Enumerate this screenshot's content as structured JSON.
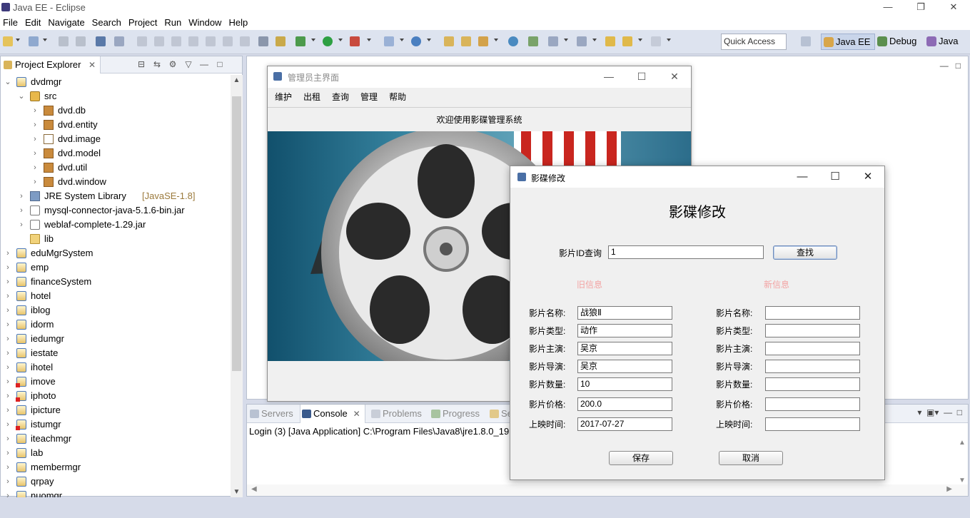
{
  "window": {
    "title": "Java EE - Eclipse",
    "controls": [
      "—",
      "❐",
      "✕"
    ]
  },
  "menubar": [
    "File",
    "Edit",
    "Navigate",
    "Search",
    "Project",
    "Run",
    "Window",
    "Help"
  ],
  "toolbar": {
    "quick_access": "Quick Access",
    "perspectives": [
      {
        "label": "Java EE",
        "active": true
      },
      {
        "label": "Debug",
        "active": false
      },
      {
        "label": "Java",
        "active": false
      }
    ]
  },
  "project_explorer": {
    "tab_label": "Project Explorer",
    "tree": [
      {
        "label": "dvdmgr",
        "icon": "project-icon",
        "twisty": "expanded",
        "level": 0
      },
      {
        "label": "src",
        "icon": "source-folder-icon",
        "twisty": "expanded",
        "level": 1
      },
      {
        "label": "dvd.db",
        "icon": "package-icon",
        "twisty": "collapsed",
        "level": 2
      },
      {
        "label": "dvd.entity",
        "icon": "package-icon",
        "twisty": "collapsed",
        "level": 2
      },
      {
        "label": "dvd.image",
        "icon": "empty-package-icon",
        "twisty": "collapsed",
        "level": 2
      },
      {
        "label": "dvd.model",
        "icon": "package-icon",
        "twisty": "collapsed",
        "level": 2
      },
      {
        "label": "dvd.util",
        "icon": "package-icon",
        "twisty": "collapsed",
        "level": 2
      },
      {
        "label": "dvd.window",
        "icon": "package-icon",
        "twisty": "collapsed",
        "level": 2
      },
      {
        "label": "JRE System Library",
        "extra": "[JavaSE-1.8]",
        "icon": "library-icon",
        "twisty": "collapsed",
        "level": 1
      },
      {
        "label": "mysql-connector-java-5.1.6-bin.jar",
        "icon": "jar-icon",
        "twisty": "collapsed",
        "level": 1
      },
      {
        "label": "weblaf-complete-1.29.jar",
        "icon": "jar-icon",
        "twisty": "collapsed",
        "level": 1
      },
      {
        "label": "lib",
        "icon": "folder-icon",
        "twisty": "none",
        "level": 1
      },
      {
        "label": "eduMgrSystem",
        "icon": "project-icon",
        "twisty": "collapsed",
        "level": 0
      },
      {
        "label": "emp",
        "icon": "project-icon",
        "twisty": "collapsed",
        "level": 0
      },
      {
        "label": "financeSystem",
        "icon": "project-icon",
        "twisty": "collapsed",
        "level": 0
      },
      {
        "label": "hotel",
        "icon": "project-icon",
        "twisty": "collapsed",
        "level": 0
      },
      {
        "label": "iblog",
        "icon": "project-icon",
        "twisty": "collapsed",
        "level": 0
      },
      {
        "label": "idorm",
        "icon": "project-icon",
        "twisty": "collapsed",
        "level": 0
      },
      {
        "label": "iedumgr",
        "icon": "project-icon",
        "twisty": "collapsed",
        "level": 0
      },
      {
        "label": "iestate",
        "icon": "project-icon",
        "twisty": "collapsed",
        "level": 0
      },
      {
        "label": "ihotel",
        "icon": "project-icon",
        "twisty": "collapsed",
        "level": 0
      },
      {
        "label": "imove",
        "icon": "error-project-icon",
        "twisty": "collapsed",
        "level": 0
      },
      {
        "label": "iphoto",
        "icon": "error-project-icon",
        "twisty": "collapsed",
        "level": 0
      },
      {
        "label": "ipicture",
        "icon": "project-icon",
        "twisty": "collapsed",
        "level": 0
      },
      {
        "label": "istumgr",
        "icon": "error-project-icon",
        "twisty": "collapsed",
        "level": 0
      },
      {
        "label": "iteachmgr",
        "icon": "project-icon",
        "twisty": "collapsed",
        "level": 0
      },
      {
        "label": "lab",
        "icon": "project-icon",
        "twisty": "collapsed",
        "level": 0
      },
      {
        "label": "membermgr",
        "icon": "project-icon",
        "twisty": "collapsed",
        "level": 0
      },
      {
        "label": "qrpay",
        "icon": "project-icon",
        "twisty": "collapsed",
        "level": 0
      },
      {
        "label": "nuomgr",
        "icon": "project-icon",
        "twisty": "collapsed",
        "level": 0
      }
    ]
  },
  "console": {
    "tabs": [
      {
        "label": "Servers",
        "active": false,
        "icon": "servers-icon"
      },
      {
        "label": "Console",
        "active": true,
        "icon": "console-icon"
      },
      {
        "label": "Problems",
        "active": false,
        "icon": "problems-icon"
      },
      {
        "label": "Progress",
        "active": false,
        "icon": "progress-icon"
      },
      {
        "label": "Se",
        "active": false,
        "icon": "search-icon"
      }
    ],
    "line": "Login (3) [Java Application] C:\\Program Files\\Java8\\jre1.8.0_191"
  },
  "main_window": {
    "title": "管理员主界面",
    "menu": [
      "维护",
      "出租",
      "查询",
      "管理",
      "帮助"
    ],
    "welcome": "欢迎使用影碟管理系统"
  },
  "dialog": {
    "title": "影碟修改",
    "heading": "影碟修改",
    "query_label": "影片ID查询",
    "query_value": "1",
    "find_button": "查找",
    "old_header": "旧信息",
    "new_header": "新信息",
    "old_fields": [
      {
        "label": "影片名称:",
        "value": "战狼Ⅱ"
      },
      {
        "label": "影片类型:",
        "value": "动作"
      },
      {
        "label": "影片主演:",
        "value": "吴京"
      },
      {
        "label": "影片导演:",
        "value": "吴京"
      },
      {
        "label": "影片数量:",
        "value": "10"
      },
      {
        "label": "影片价格:",
        "value": "200.0"
      },
      {
        "label": "上映时间:",
        "value": "2017-07-27"
      }
    ],
    "new_fields": [
      {
        "label": "影片名称:",
        "value": ""
      },
      {
        "label": "影片类型:",
        "value": ""
      },
      {
        "label": "影片主演:",
        "value": ""
      },
      {
        "label": "影片导演:",
        "value": ""
      },
      {
        "label": "影片数量:",
        "value": ""
      },
      {
        "label": "影片价格:",
        "value": ""
      },
      {
        "label": "上映时间:",
        "value": ""
      }
    ],
    "save_button": "保存",
    "cancel_button": "取消"
  },
  "colors": {
    "accent": "#4b77b8",
    "hint_pink": "#f3a3a3",
    "chrome": "#d6dbe9"
  }
}
